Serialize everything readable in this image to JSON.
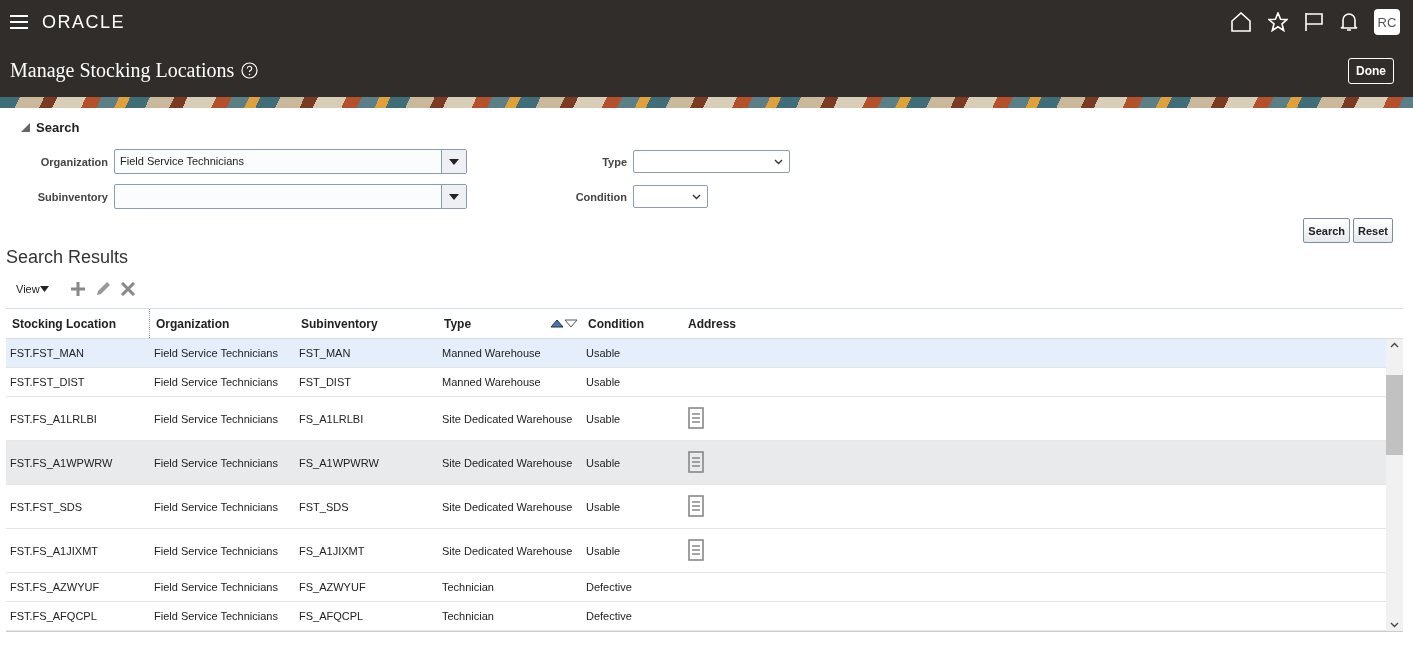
{
  "header": {
    "logo": "ORACLE",
    "avatar": "RC",
    "title": "Manage Stocking Locations",
    "done_button": "Done"
  },
  "search": {
    "heading": "Search",
    "expanded": true,
    "fields": [
      {
        "label": "Organization",
        "value": "Field Service Technicians",
        "kind": "combo"
      },
      {
        "label": "Type",
        "kind": "select"
      },
      {
        "label": "Subinventory",
        "kind": "combo"
      },
      {
        "label": "Condition",
        "kind": "select-small"
      }
    ],
    "buttons": [
      "Search",
      "Reset"
    ]
  },
  "results": {
    "heading": "Search Results",
    "view_menu": "View",
    "columns": [
      "Stocking Location",
      "Organization",
      "Subinventory",
      "Type",
      "Condition",
      "Address"
    ],
    "rows": [
      {
        "cells": [
          "FST.FST_MAN",
          "Field Service Technicians",
          "FST_MAN",
          "Manned Warehouse",
          "Usable"
        ],
        "address_icon": false,
        "selected": true,
        "hovered": false
      },
      {
        "cells": [
          "FST.FST_DIST",
          "Field Service Technicians",
          "FST_DIST",
          "Manned Warehouse",
          "Usable"
        ],
        "address_icon": false,
        "selected": false,
        "hovered": false
      },
      {
        "cells": [
          "FST.FS_A1LRLBI",
          "Field Service Technicians",
          "FS_A1LRLBI",
          "Site Dedicated Warehouse",
          "Usable"
        ],
        "address_icon": true,
        "selected": false,
        "hovered": false
      },
      {
        "cells": [
          "FST.FS_A1WPWRW",
          "Field Service Technicians",
          "FS_A1WPWRW",
          "Site Dedicated Warehouse",
          "Usable"
        ],
        "address_icon": true,
        "selected": false,
        "hovered": true
      },
      {
        "cells": [
          "FST.FST_SDS",
          "Field Service Technicians",
          "FST_SDS",
          "Site Dedicated Warehouse",
          "Usable"
        ],
        "address_icon": true,
        "selected": false,
        "hovered": false
      },
      {
        "cells": [
          "FST.FS_A1JIXMT",
          "Field Service Technicians",
          "FS_A1JIXMT",
          "Site Dedicated Warehouse",
          "Usable"
        ],
        "address_icon": true,
        "selected": false,
        "hovered": false
      },
      {
        "cells": [
          "FST.FS_AZWYUF",
          "Field Service Technicians",
          "FS_AZWYUF",
          "Technician",
          "Defective"
        ],
        "address_icon": false,
        "selected": false,
        "hovered": false
      },
      {
        "cells": [
          "FST.FS_AFQCPL",
          "Field Service Technicians",
          "FS_AFQCPL",
          "Technician",
          "Defective"
        ],
        "address_icon": false,
        "selected": false,
        "hovered": false
      }
    ]
  }
}
